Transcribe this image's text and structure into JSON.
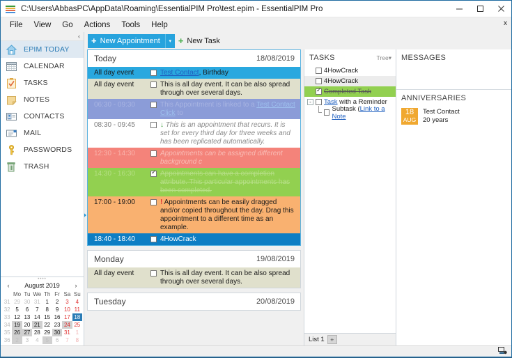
{
  "window": {
    "title": "C:\\Users\\AbbasPC\\AppData\\Roaming\\EssentialPIM Pro\\test.epim - EssentialPIM Pro",
    "app_icon": "epim-logo-icon",
    "minimize_label": "–",
    "maximize_label": "☐",
    "close_label": "✕",
    "tab_close_label": "x"
  },
  "menubar": {
    "items": [
      {
        "label": "File"
      },
      {
        "label": "View"
      },
      {
        "label": "Go"
      },
      {
        "label": "Actions"
      },
      {
        "label": "Tools"
      },
      {
        "label": "Help"
      }
    ]
  },
  "sidebar": {
    "collapse_label": "‹",
    "items": [
      {
        "label": "EPIM TODAY",
        "icon": "home-icon",
        "active": true
      },
      {
        "label": "CALENDAR",
        "icon": "calendar-icon",
        "active": false
      },
      {
        "label": "TASKS",
        "icon": "tasks-clipboard-icon",
        "active": false
      },
      {
        "label": "NOTES",
        "icon": "notes-icon",
        "active": false
      },
      {
        "label": "CONTACTS",
        "icon": "contacts-icon",
        "active": false
      },
      {
        "label": "MAIL",
        "icon": "mail-icon",
        "active": false
      },
      {
        "label": "PASSWORDS",
        "icon": "key-icon",
        "active": false
      },
      {
        "label": "TRASH",
        "icon": "trash-icon",
        "active": false
      }
    ]
  },
  "minicalendar": {
    "prev_label": "‹",
    "next_label": "›",
    "title": "August  2019",
    "weekday_headers": [
      "",
      "Mo",
      "Tu",
      "We",
      "Th",
      "Fr",
      "Sa",
      "Su"
    ],
    "weeks": [
      {
        "wk": "31",
        "days": [
          {
            "n": "29",
            "other": true
          },
          {
            "n": "30",
            "other": true
          },
          {
            "n": "31",
            "other": true
          },
          {
            "n": "1"
          },
          {
            "n": "2"
          },
          {
            "n": "3",
            "weekend": true
          },
          {
            "n": "4",
            "weekend": true
          }
        ]
      },
      {
        "wk": "32",
        "days": [
          {
            "n": "5"
          },
          {
            "n": "6"
          },
          {
            "n": "7"
          },
          {
            "n": "8"
          },
          {
            "n": "9"
          },
          {
            "n": "10",
            "weekend": true
          },
          {
            "n": "11",
            "weekend": true
          }
        ]
      },
      {
        "wk": "33",
        "days": [
          {
            "n": "12"
          },
          {
            "n": "13"
          },
          {
            "n": "14"
          },
          {
            "n": "15"
          },
          {
            "n": "16"
          },
          {
            "n": "17",
            "weekend": true
          },
          {
            "n": "18",
            "selected": true
          }
        ]
      },
      {
        "wk": "34",
        "days": [
          {
            "n": "19",
            "highlight": true
          },
          {
            "n": "20"
          },
          {
            "n": "21",
            "highlight": true
          },
          {
            "n": "22"
          },
          {
            "n": "23"
          },
          {
            "n": "24",
            "weekend": true,
            "highlight": true
          },
          {
            "n": "25",
            "weekend": true
          }
        ]
      },
      {
        "wk": "35",
        "days": [
          {
            "n": "26",
            "highlight": true
          },
          {
            "n": "27",
            "highlight": true
          },
          {
            "n": "28"
          },
          {
            "n": "29"
          },
          {
            "n": "30",
            "highlight": true
          },
          {
            "n": "31",
            "weekend": true
          },
          {
            "n": "1",
            "weekend": true,
            "other": true
          }
        ]
      },
      {
        "wk": "36",
        "days": [
          {
            "n": "2",
            "other": true,
            "highlight": true
          },
          {
            "n": "3",
            "other": true
          },
          {
            "n": "4",
            "other": true
          },
          {
            "n": "5",
            "other": true,
            "highlight": true
          },
          {
            "n": "6",
            "other": true
          },
          {
            "n": "7",
            "other": true,
            "weekend": true
          },
          {
            "n": "8",
            "other": true,
            "weekend": true
          }
        ]
      }
    ]
  },
  "toolbar": {
    "new_appointment_label": "New Appointment",
    "new_appointment_dropdown": "▾",
    "new_task_label": "New Task",
    "plus_glyph": "+"
  },
  "today_panel": {
    "days": [
      {
        "name": "Today",
        "date": "18/08/2019",
        "accent": true,
        "appointments": [
          {
            "time": "All day event",
            "checked": false,
            "bg": "#29a8df",
            "time_color": "#1a1a1a",
            "text_color": "#1a1a1a",
            "segments": [
              {
                "t": "Test Contact",
                "link": true
              },
              {
                "t": ", Birthday"
              }
            ]
          },
          {
            "time": "All day event",
            "checked": false,
            "bg": "#e0e0cc",
            "time_color": "#1a1a1a",
            "text_color": "#1a1a1a",
            "segments": [
              {
                "t": "This is all day event. It can be also spread through over several days."
              }
            ]
          },
          {
            "time": "06:30 - 09:30",
            "checked": false,
            "bg": "#8b9cd8",
            "time_color": "#a8b4e2",
            "text_color": "#a8b4e2",
            "segments": [
              {
                "t": "This Appointment is linked to a "
              },
              {
                "t": "Test Contact",
                "link": true,
                "pale": true
              },
              {
                "t": " "
              },
              {
                "t": "Click",
                "link": true,
                "pale": true
              },
              {
                "t": " to"
              }
            ]
          },
          {
            "time": "08:30 - 09:45",
            "checked": false,
            "bg": "#ffffff",
            "time_color": "#7a7a7a",
            "text_color": "#8a8a8a",
            "icon": "arrow-down-icon",
            "italic": true,
            "segments": [
              {
                "t": "This is an appointment that "
              },
              {
                "t": "recurs",
                "bold": true
              },
              {
                "t": ". It is set for every third day for three weeks and has been replicated automatically."
              }
            ]
          },
          {
            "time": "12:30 - 14:30",
            "checked": false,
            "bg": "#f4837a",
            "time_color": "#f9b3ab",
            "text_color": "#f9bdb6",
            "italic": true,
            "segments": [
              {
                "t": "Appointments can be assigned different "
              },
              {
                "t": "background",
                "bold": true
              },
              {
                "t": " c"
              }
            ]
          },
          {
            "time": "14:30 - 16:30",
            "checked": true,
            "bg": "#92d050",
            "time_color": "#b6df86",
            "text_color": "#b6df86",
            "strike": true,
            "segments": [
              {
                "t": "Appointments can have a "
              },
              {
                "t": "completion attribute",
                "bold": true
              },
              {
                "t": ". This particular appointments has been completed."
              }
            ]
          },
          {
            "time": "17:00 - 19:00",
            "checked": false,
            "bg": "#f9b170",
            "time_color": "#1a1a1a",
            "text_color": "#1a1a1a",
            "icon": "exclamation-icon",
            "marker": true,
            "segments": [
              {
                "t": "Appointments can be easily dragged and/or copied throughout the day. Drag this appointment to a different time as an example."
              }
            ]
          },
          {
            "time": "18:40 - 18:40",
            "checked": false,
            "bg": "#0d7ec4",
            "time_color": "#ffffff",
            "text_color": "#ffffff",
            "segments": [
              {
                "t": "4HowCrack"
              }
            ]
          }
        ]
      },
      {
        "name": "Monday",
        "date": "19/08/2019",
        "accent": false,
        "appointments": [
          {
            "time": "All day event",
            "checked": false,
            "bg": "#e0e0cc",
            "time_color": "#1a1a1a",
            "text_color": "#1a1a1a",
            "segments": [
              {
                "t": "This is all day event. It can be also spread through over several days."
              }
            ]
          }
        ]
      },
      {
        "name": "Tuesday",
        "date": "20/08/2019",
        "accent": false,
        "appointments": []
      }
    ]
  },
  "tasks_panel": {
    "title": "TASKS",
    "view_label": "Tree",
    "view_dropdown": "▾",
    "rows": [
      {
        "indent": 0,
        "expander": "",
        "checked": false,
        "segments": [
          {
            "t": "4HowCrack"
          }
        ],
        "style": ""
      },
      {
        "indent": 0,
        "expander": "",
        "checked": false,
        "segments": [
          {
            "t": "4HowCrack"
          }
        ],
        "style": "alt"
      },
      {
        "indent": 0,
        "expander": "",
        "checked": true,
        "segments": [
          {
            "t": "Completed Task"
          }
        ],
        "style": "done"
      },
      {
        "indent": 0,
        "expander": "-",
        "checked": false,
        "segments": [
          {
            "t": "Task",
            "link": true
          },
          {
            "t": " with a "
          },
          {
            "t": "Reminder",
            "bold": true
          }
        ],
        "style": ""
      },
      {
        "indent": 1,
        "expander": "",
        "checked": false,
        "segments": [
          {
            "t": "Subtask ("
          },
          {
            "t": "Link to a Note",
            "link": true
          }
        ],
        "style": ""
      }
    ],
    "tab_label": "List 1",
    "add_tab_label": "+"
  },
  "messages_panel": {
    "title": "MESSAGES",
    "items": []
  },
  "anniversaries_panel": {
    "title": "ANNIVERSARIES",
    "items": [
      {
        "day": "18",
        "month": "AUG",
        "name": "Test Contact",
        "detail": "20 years"
      }
    ]
  },
  "statusbar": {
    "sync_icon": "sync-settings-icon"
  },
  "colors": {
    "accent": "#27a3dd",
    "window_border": "#1e6ba1",
    "selection": "#2a7bb5",
    "completed": "#92d050",
    "anniversary_badge": "#f0a830"
  }
}
